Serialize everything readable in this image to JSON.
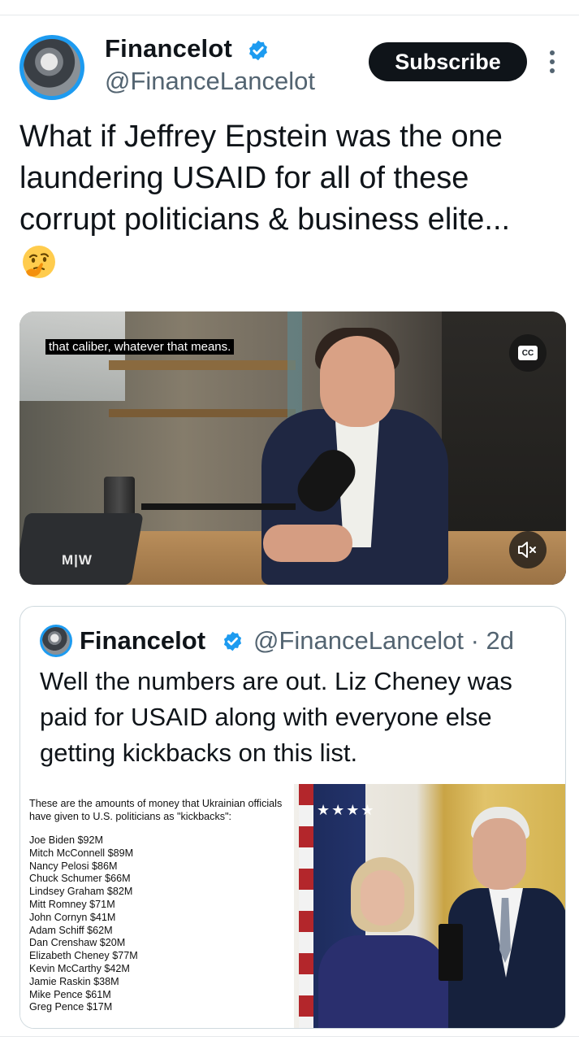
{
  "post": {
    "author_name": "Financelot",
    "author_handle": "@FinanceLancelot",
    "subscribe_label": "Subscribe",
    "text": "What if Jeffrey Epstein was the one laundering USAID for all of these corrupt politicians & business elite...",
    "emoji": "thinking-face"
  },
  "video": {
    "caption": "that caliber, whatever that means.",
    "watermark": "M|W",
    "cc_label": "CC",
    "mute_icon": "speaker-muted-icon"
  },
  "quote": {
    "author_name": "Financelot",
    "author_handle": "@FinanceLancelot · 2d",
    "text": "Well the numbers are out. Liz Cheney was paid for USAID along with everyone else getting kickbacks on this list.",
    "image_intro": "These are the amounts of money that Ukrainian officials have given to U.S. politicians as \"kickbacks\":",
    "image_list": [
      "Joe Biden $92M",
      "Mitch McConnell $89M",
      "Nancy Pelosi $86M",
      "Chuck Schumer $66M",
      "Lindsey Graham $82M",
      "Mitt Romney $71M",
      "John Cornyn $41M",
      "Adam Schiff $62M",
      "Dan Crenshaw $20M",
      "Elizabeth Cheney $77M",
      "Kevin McCarthy $42M",
      "Jamie Raskin $38M",
      "Mike Pence $61M",
      "Greg Pence $17M"
    ]
  },
  "colors": {
    "verified_blue": "#1d9bf0",
    "text_primary": "#0f1419",
    "text_secondary": "#536471",
    "border": "#cfd9de"
  }
}
